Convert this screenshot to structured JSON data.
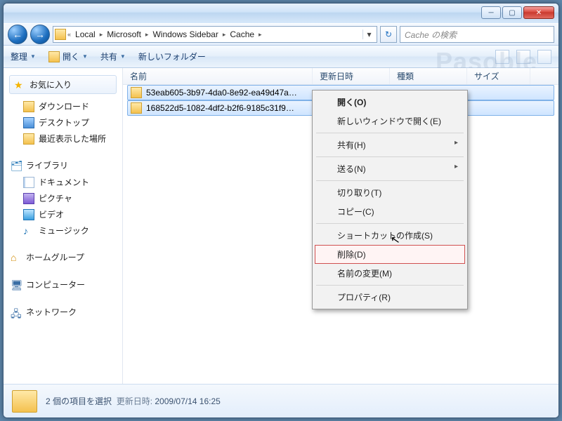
{
  "titlebar": {
    "min": "─",
    "max": "▢",
    "close": "✕"
  },
  "nav_buttons": {
    "back": "←",
    "fwd": "→"
  },
  "breadcrumbs": [
    "Local",
    "Microsoft",
    "Windows Sidebar",
    "Cache"
  ],
  "search_placeholder": "Cache の検索",
  "toolbar": {
    "organize": "整理",
    "open": "開く",
    "share": "共有",
    "newfolder": "新しいフォルダー"
  },
  "columns": {
    "name": "名前",
    "date": "更新日時",
    "type": "種類",
    "size": "サイズ"
  },
  "sidebar": {
    "favorites": "お気に入り",
    "downloads": "ダウンロード",
    "desktop": "デスクトップ",
    "recent": "最近表示した場所",
    "libraries": "ライブラリ",
    "documents": "ドキュメント",
    "pictures": "ピクチャ",
    "videos": "ビデオ",
    "music": "ミュージック",
    "homegroup": "ホームグループ",
    "computer": "コンピューター",
    "network": "ネットワーク"
  },
  "files": [
    "53eab605-3b97-4da0-8e92-ea49d47a…",
    "168522d5-1082-4df2-b2f6-9185c31f9…"
  ],
  "context_menu": {
    "open": "開く(O)",
    "open_new": "新しいウィンドウで開く(E)",
    "share": "共有(H)",
    "sendto": "送る(N)",
    "cut": "切り取り(T)",
    "copy": "コピー(C)",
    "shortcut": "ショートカットの作成(S)",
    "delete": "削除(D)",
    "rename": "名前の変更(M)",
    "properties": "プロパティ(R)"
  },
  "status": {
    "count": "2 個の項目を選択",
    "date_label": "更新日時:",
    "date": "2009/07/14 16:25"
  },
  "watermark": "Pasoble"
}
